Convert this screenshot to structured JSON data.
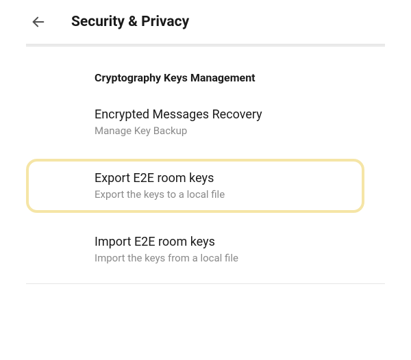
{
  "header": {
    "title": "Security & Privacy"
  },
  "section": {
    "heading": "Cryptography Keys Management",
    "items": [
      {
        "title": "Encrypted Messages Recovery",
        "subtitle": "Manage Key Backup"
      },
      {
        "title": "Export E2E room keys",
        "subtitle": "Export the keys to a local file"
      },
      {
        "title": "Import E2E room keys",
        "subtitle": "Import the keys from a local file"
      }
    ]
  }
}
